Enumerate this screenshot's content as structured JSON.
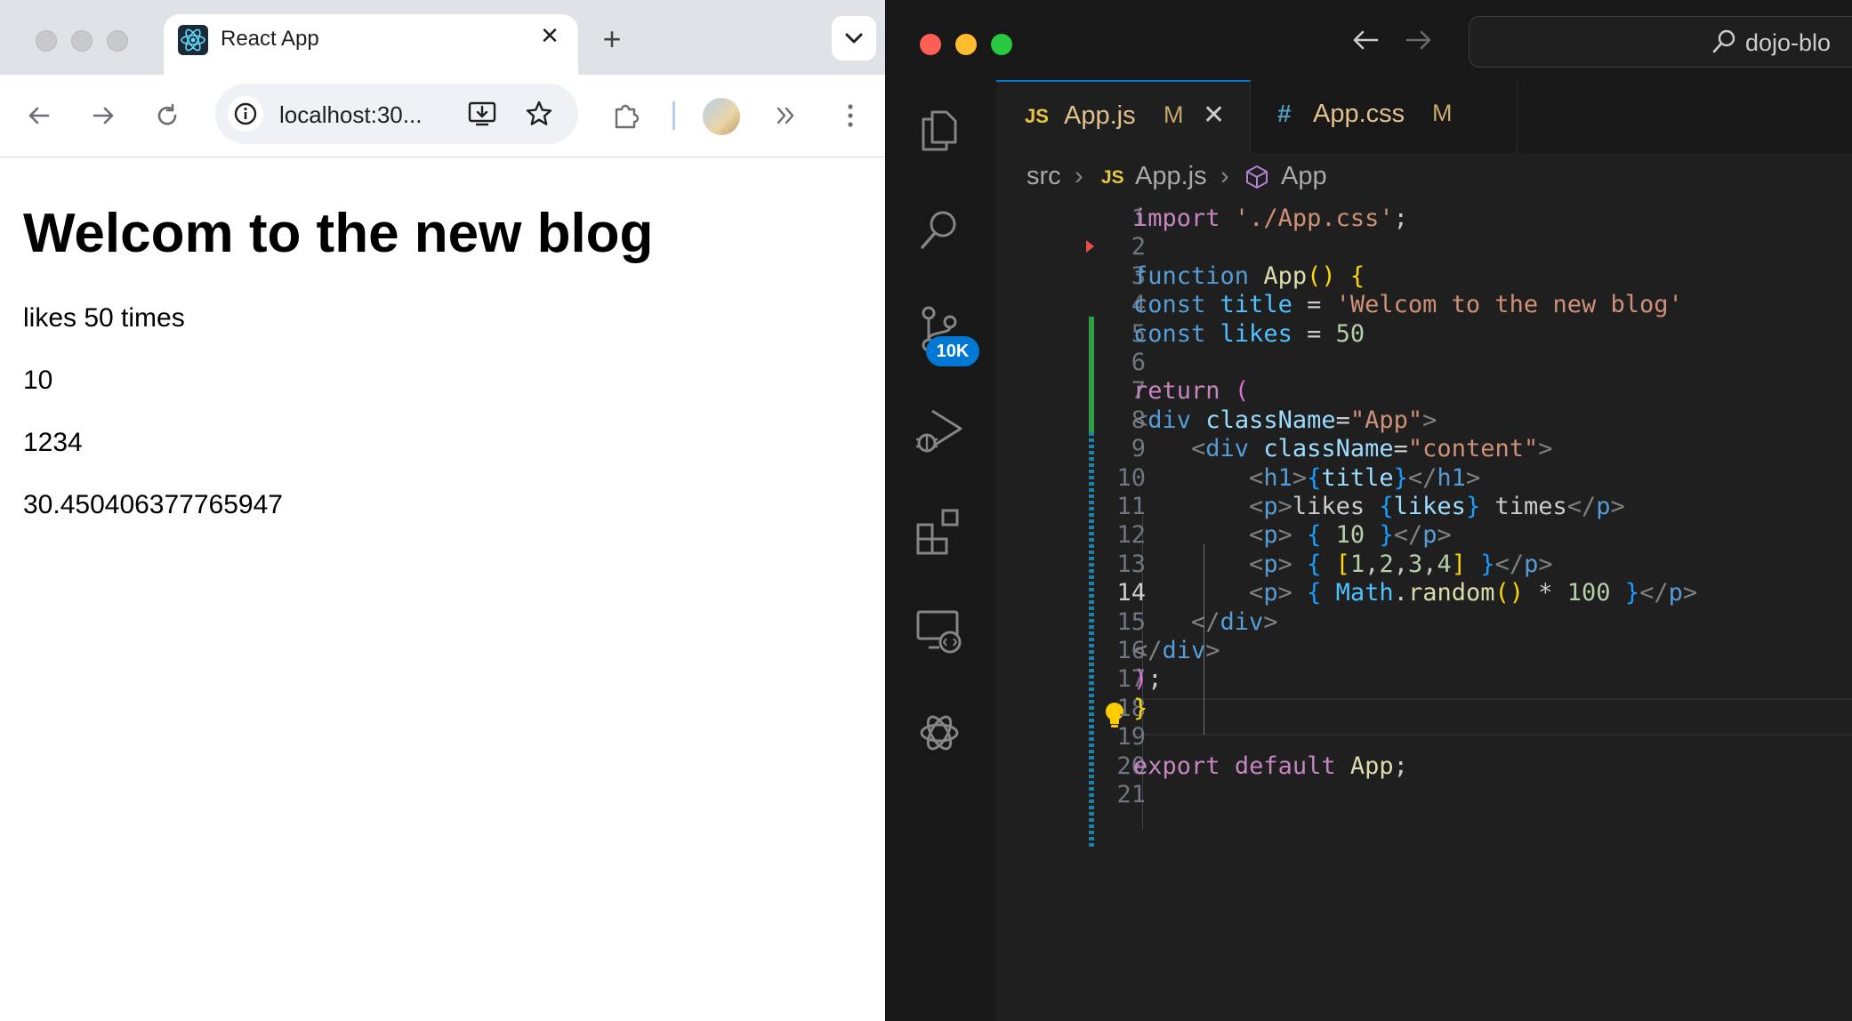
{
  "browser": {
    "tab_title": "React App",
    "address": "localhost:30...",
    "page": {
      "heading": "Welcom to the new blog",
      "lines": [
        "likes 50 times",
        "10",
        "1234",
        "30.450406377765947"
      ]
    }
  },
  "vscode": {
    "command_center": "dojo-blo",
    "scm_badge": "10K",
    "tabs": [
      {
        "icon": "JS",
        "name": "App.js",
        "status": "M",
        "active": true
      },
      {
        "icon": "#",
        "name": "App.css",
        "status": "M",
        "active": false
      }
    ],
    "breadcrumbs": {
      "folder": "src",
      "file_icon": "JS",
      "file": "App.js",
      "symbol": "App"
    },
    "current_line": 14,
    "line_numbers": [
      "1",
      "2",
      "3",
      "4",
      "5",
      "6",
      "7",
      "8",
      "9",
      "10",
      "11",
      "12",
      "13",
      "14",
      "15",
      "16",
      "17",
      "18",
      "19",
      "20",
      "21"
    ],
    "code_lines": [
      "import './App.css';",
      "",
      "function App() {",
      "const title = 'Welcom to the new blog'",
      "const likes = 50",
      "",
      "return (",
      "<div className=\"App\">",
      "    <div className=\"content\">",
      "        <h1>{title}</h1>",
      "        <p>likes {likes} times</p>",
      "        <p> { 10 }</p>",
      "        <p> { [1,2,3,4] }</p>",
      "        <p> { Math.random() * 100 }</p>",
      "    </div>",
      "</div>",
      ");",
      "}",
      "",
      "export default App;",
      ""
    ],
    "colors": {
      "accent": "#0078d4",
      "added": "#2ea043",
      "modified": "#1b81a8"
    }
  }
}
